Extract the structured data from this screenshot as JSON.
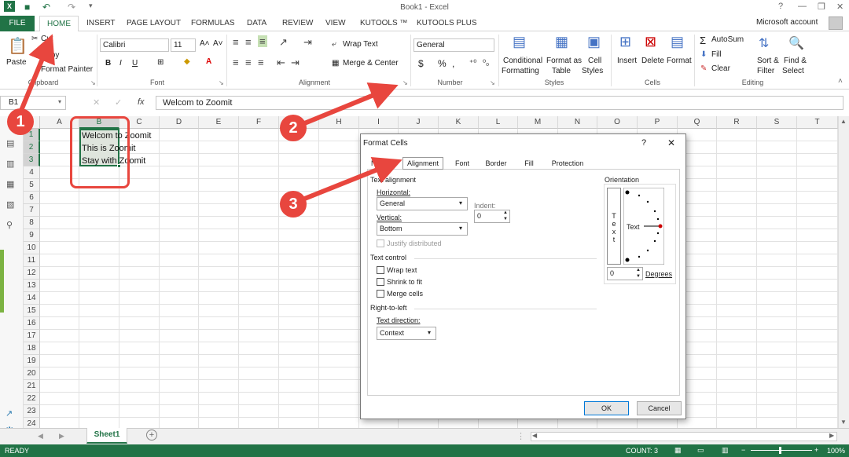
{
  "window": {
    "title": "Book1 - Excel",
    "help": "?",
    "account": "Microsoft account"
  },
  "tabs": [
    "FILE",
    "HOME",
    "INSERT",
    "PAGE LAYOUT",
    "FORMULAS",
    "DATA",
    "REVIEW",
    "VIEW",
    "KUTOOLS ™",
    "KUTOOLS PLUS"
  ],
  "ribbon": {
    "clipboard": {
      "paste": "Paste",
      "cut": "Cut",
      "copy": "Copy",
      "painter": "Format Painter",
      "label": "Clipboard"
    },
    "font": {
      "name": "Calibri",
      "size": "11",
      "bold": "B",
      "italic": "I",
      "underline": "U",
      "label": "Font"
    },
    "alignment": {
      "wrap": "Wrap Text",
      "merge": "Merge & Center",
      "label": "Alignment"
    },
    "number": {
      "format": "General",
      "currency": "$",
      "percent": "%",
      "comma": ",",
      "label": "Number"
    },
    "styles": {
      "cond1": "Conditional",
      "cond2": "Formatting",
      "table1": "Format as",
      "table2": "Table",
      "cell1": "Cell",
      "cell2": "Styles",
      "label": "Styles"
    },
    "cells": {
      "insert": "Insert",
      "delete": "Delete",
      "format": "Format",
      "label": "Cells"
    },
    "editing": {
      "autosum": "AutoSum",
      "fill": "Fill",
      "clear": "Clear",
      "sort1": "Sort &",
      "sort2": "Filter",
      "find1": "Find &",
      "find2": "Select",
      "label": "Editing"
    }
  },
  "formula_bar": {
    "name_box": "B1",
    "fx": "fx",
    "value": "Welcom to Zoomit"
  },
  "columns": [
    "A",
    "B",
    "C",
    "D",
    "E",
    "F",
    "G",
    "H",
    "I",
    "J",
    "K",
    "L",
    "M",
    "N",
    "O",
    "P",
    "Q",
    "R",
    "S",
    "T"
  ],
  "rows": [
    "1",
    "2",
    "3",
    "4",
    "5",
    "6",
    "7",
    "8",
    "9",
    "10",
    "11",
    "12",
    "13",
    "14",
    "15",
    "16",
    "17",
    "18",
    "19",
    "20",
    "21",
    "22",
    "23",
    "24"
  ],
  "cells": {
    "b1": "Welcom to Zoomit",
    "b2": "This is Zoomit",
    "b3": "Stay with Zoomit"
  },
  "dialog": {
    "title": "Format Cells",
    "help": "?",
    "close": "✕",
    "tabs": [
      "Number",
      "Alignment",
      "Font",
      "Border",
      "Fill",
      "Protection"
    ],
    "text_alignment": "Text alignment",
    "horizontal_label": "Horizontal:",
    "horizontal_value": "General",
    "indent_label": "Indent:",
    "indent_value": "0",
    "vertical_label": "Vertical:",
    "vertical_value": "Bottom",
    "justify": "Justify distributed",
    "text_control": "Text control",
    "wrap": "Wrap text",
    "shrink": "Shrink to fit",
    "merge": "Merge cells",
    "rtl": "Right-to-left",
    "direction_label": "Text direction:",
    "direction_value": "Context",
    "orientation": "Orientation",
    "vertical_text": [
      "T",
      "e",
      "x",
      "t"
    ],
    "dial_text": "Text",
    "degrees_value": "0",
    "degrees_label": "Degrees",
    "ok": "OK",
    "cancel": "Cancel"
  },
  "sheet": {
    "name": "Sheet1",
    "add": "+"
  },
  "status": {
    "mode": "READY",
    "count": "COUNT: 3",
    "zoom": "100%"
  },
  "annotations": {
    "a1": "1",
    "a2": "2",
    "a3": "3"
  },
  "colors": {
    "excel_green": "#217346",
    "annotation_red": "#e8463e"
  }
}
